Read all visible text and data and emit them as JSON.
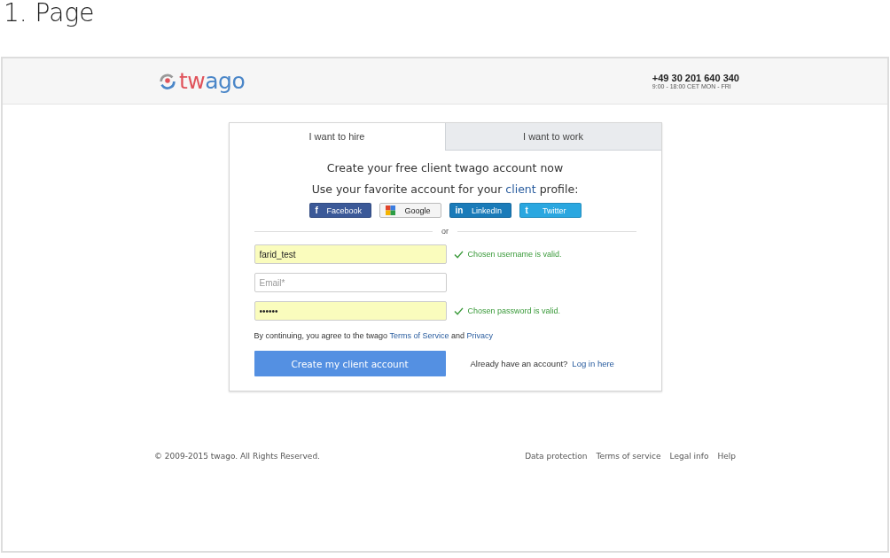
{
  "page_title": "1. Page",
  "header": {
    "logo": [
      {
        "text": "tw",
        "color": "#e0525a"
      },
      {
        "text": "ago",
        "color": "#4a86c8"
      }
    ],
    "phone": "+49 30 201 640 340",
    "hours": "9:00 - 18:00 CET MON - FRI"
  },
  "tabs": [
    {
      "label": "I want to hire",
      "selected": true
    },
    {
      "label": "I want to work",
      "selected": false
    }
  ],
  "heading": "Create your free client twago account now",
  "subheading": {
    "before": "Use your favorite account for your ",
    "link": "client",
    "after": " profile:"
  },
  "social_buttons": [
    {
      "kind": "facebook",
      "icon": "f",
      "label": "Facebook"
    },
    {
      "kind": "google",
      "label": "Google"
    },
    {
      "kind": "linkedin",
      "icon": "in",
      "label": "LinkedIn"
    },
    {
      "kind": "twitter",
      "icon": "t",
      "label": "Twitter"
    }
  ],
  "divider_text": "or",
  "fields": [
    {
      "value": "farid_test",
      "valid": true,
      "message": "Chosen username is valid."
    },
    {
      "placeholder": "Email*",
      "valid": false
    },
    {
      "value": "••••••",
      "valid": true,
      "message": "Chosen password is valid."
    }
  ],
  "agreement": {
    "before": "By continuing, you agree to the twago ",
    "terms_link": "Terms of Service",
    "middle": " and ",
    "privacy_link": "Privacy"
  },
  "submit_button": "Create my client account",
  "login_prompt": "Already have an account?",
  "login_link": "Log in here",
  "footer": {
    "copyright": "© 2009-2015 twago. All Rights Reserved.",
    "links": [
      "Data protection",
      "Terms of service",
      "Legal info",
      "Help"
    ]
  }
}
